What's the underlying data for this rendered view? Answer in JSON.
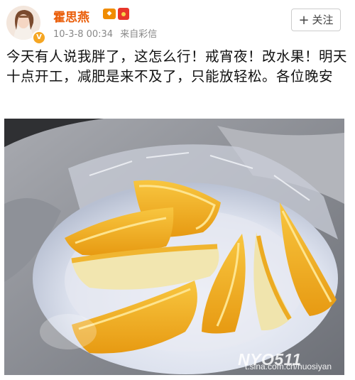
{
  "post": {
    "username": "霍思燕",
    "badges": [
      "vip-badge",
      "hongbao-icon"
    ],
    "verified_icon": "verified-v-icon",
    "timestamp": "10-3-8 00:34",
    "source": "来自彩信",
    "follow_label": "关注",
    "text": "今天有人说我胖了，这怎么行！戒宵夜！改水果！明天十点开工，减肥是来不及了，只能放轻松。各位晚安"
  },
  "photo": {
    "watermark": "NYO511",
    "watermark_link": "t.sina.com.cn/huosiyan"
  },
  "colors": {
    "username": "#ea5d08",
    "meta": "#888888",
    "text": "#111111"
  }
}
